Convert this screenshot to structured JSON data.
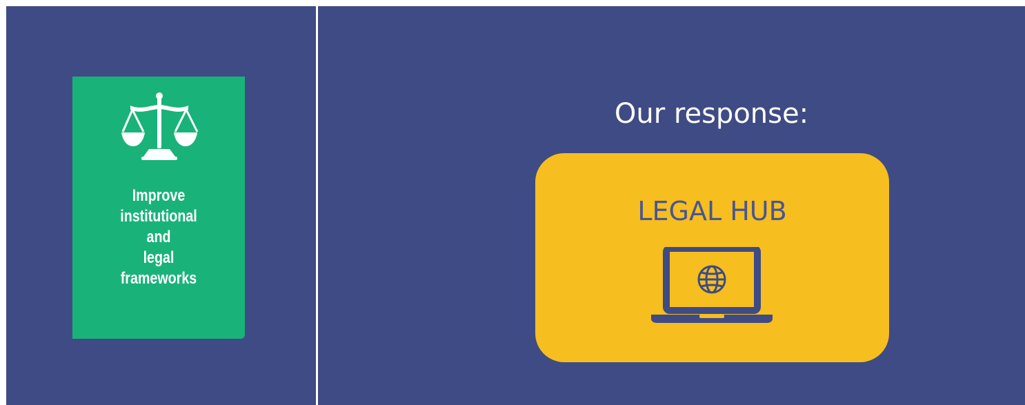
{
  "theme": {
    "panel_bg": "#3f4b84",
    "card_green": "#19b37a",
    "hub_yellow": "#f6be1f",
    "hub_text": "#4a5592",
    "divider": "#ffffff"
  },
  "goal": {
    "icon": "scale-of-justice-icon",
    "lines": [
      "Improve",
      "institutional",
      "and",
      "legal",
      "frameworks"
    ]
  },
  "response": {
    "title": "Our response:",
    "hub": {
      "label": "LEGAL HUB",
      "icon": "laptop-globe-icon"
    }
  }
}
